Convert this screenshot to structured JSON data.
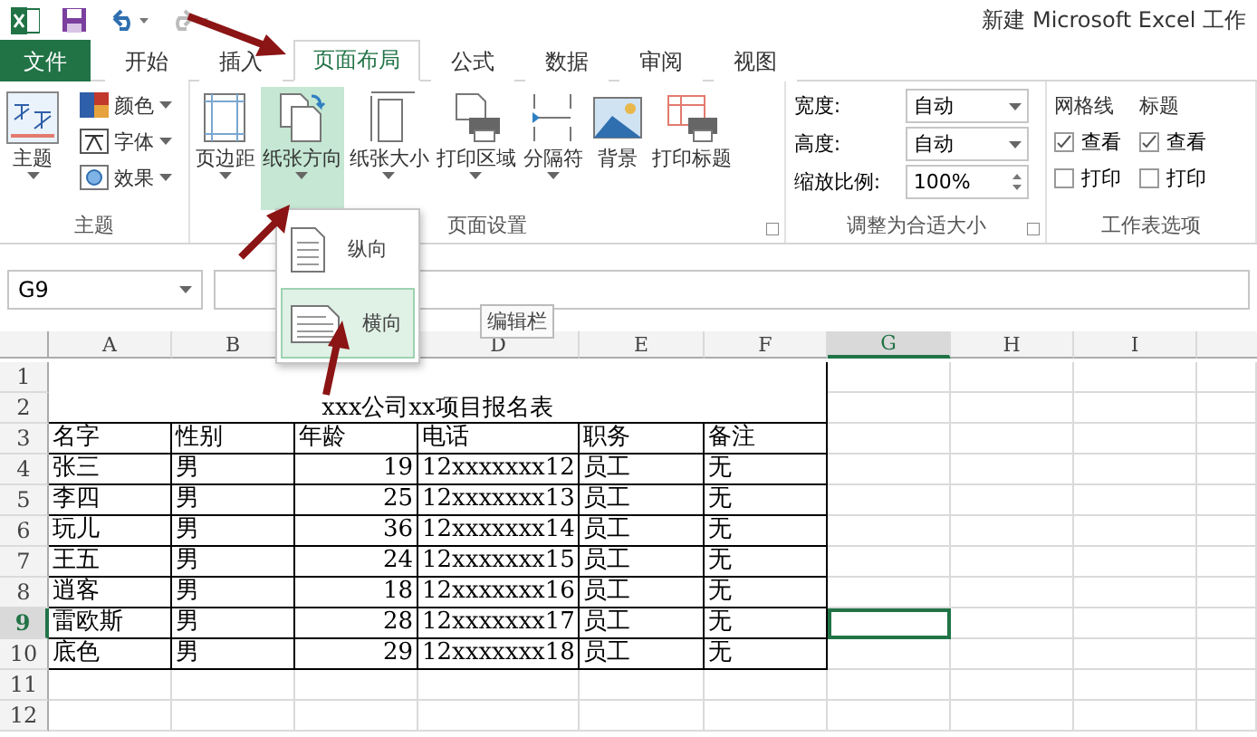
{
  "title_bar": {
    "title": "新建 Microsoft Excel 工作"
  },
  "tabs": [
    {
      "label": "文件",
      "kind": "file",
      "selected": false
    },
    {
      "label": "开始",
      "kind": "tab",
      "selected": false
    },
    {
      "label": "插入",
      "kind": "tab",
      "selected": false
    },
    {
      "label": "页面布局",
      "kind": "tab",
      "selected": true
    },
    {
      "label": "公式",
      "kind": "tab",
      "selected": false
    },
    {
      "label": "数据",
      "kind": "tab",
      "selected": false
    },
    {
      "label": "审阅",
      "kind": "tab",
      "selected": false
    },
    {
      "label": "视图",
      "kind": "tab",
      "selected": false
    }
  ],
  "ribbon": {
    "theme_group": {
      "label": "主题",
      "theme_button": "主题",
      "items": [
        "颜色",
        "字体",
        "效果"
      ]
    },
    "page_setup_group": {
      "label": "页面设置",
      "buttons": [
        {
          "label": "页边距",
          "dropdown": true,
          "selected": false
        },
        {
          "label": "纸张方向",
          "dropdown": true,
          "selected": true
        },
        {
          "label": "纸张大小",
          "dropdown": true,
          "selected": false
        },
        {
          "label": "打印区域",
          "dropdown": true,
          "selected": false
        },
        {
          "label": "分隔符",
          "dropdown": true,
          "selected": false
        },
        {
          "label": "背景",
          "dropdown": false,
          "selected": false
        },
        {
          "label": "打印标题",
          "dropdown": false,
          "selected": false
        }
      ]
    },
    "scale_group": {
      "label": "调整为合适大小",
      "fields": [
        {
          "label": "宽度:",
          "value": "自动",
          "kind": "select"
        },
        {
          "label": "高度:",
          "value": "自动",
          "kind": "select"
        },
        {
          "label": "缩放比例:",
          "value": "100%",
          "kind": "spin"
        }
      ]
    },
    "sheet_options_group": {
      "label": "工作表选项",
      "columns": [
        {
          "heading": "网格线",
          "options": [
            {
              "label": "查看",
              "checked": true
            },
            {
              "label": "打印",
              "checked": false
            }
          ]
        },
        {
          "heading": "标题",
          "options": [
            {
              "label": "查看",
              "checked": true
            },
            {
              "label": "打印",
              "checked": false
            }
          ]
        }
      ]
    }
  },
  "orientation_menu": [
    {
      "label": "纵向",
      "kind": "portrait",
      "selected": false
    },
    {
      "label": "横向",
      "kind": "landscape",
      "selected": true
    }
  ],
  "name_box": "G9",
  "tooltip": "编辑栏",
  "sheet": {
    "columns": [
      {
        "label": "A",
        "selected": false
      },
      {
        "label": "B",
        "selected": false
      },
      {
        "selected": false
      },
      {
        "label": "D",
        "selected": false
      },
      {
        "label": "E",
        "selected": false
      },
      {
        "label": "F",
        "selected": false
      },
      {
        "label": "G",
        "selected": true
      },
      {
        "label": "H",
        "selected": false
      },
      {
        "label": "I",
        "selected": false
      }
    ],
    "title": "xxx公司xx项目报名表",
    "header": [
      "名字",
      "性别",
      "年龄",
      "电话",
      "职务",
      "备注"
    ],
    "rows": [
      [
        "张三",
        "男",
        "19",
        "12xxxxxxx12",
        "员工",
        "无"
      ],
      [
        "李四",
        "男",
        "25",
        "12xxxxxxx13",
        "员工",
        "无"
      ],
      [
        "玩儿",
        "男",
        "36",
        "12xxxxxxx14",
        "员工",
        "无"
      ],
      [
        "王五",
        "男",
        "24",
        "12xxxxxxx15",
        "员工",
        "无"
      ],
      [
        "逍客",
        "男",
        "18",
        "12xxxxxxx16",
        "员工",
        "无"
      ],
      [
        "雷欧斯",
        "男",
        "28",
        "12xxxxxxx17",
        "员工",
        "无"
      ],
      [
        "底色",
        "男",
        "29",
        "12xxxxxxx18",
        "员工",
        "无"
      ]
    ],
    "row_numbers": [
      {
        "label": "1",
        "selected": false
      },
      {
        "label": "2",
        "selected": false
      },
      {
        "label": "3",
        "selected": false
      },
      {
        "label": "4",
        "selected": false
      },
      {
        "label": "5",
        "selected": false
      },
      {
        "label": "6",
        "selected": false
      },
      {
        "label": "7",
        "selected": false
      },
      {
        "label": "8",
        "selected": false
      },
      {
        "label": "9",
        "selected": true
      },
      {
        "label": "10",
        "selected": false
      },
      {
        "label": "11",
        "selected": false
      },
      {
        "label": "12",
        "selected": false
      }
    ]
  }
}
